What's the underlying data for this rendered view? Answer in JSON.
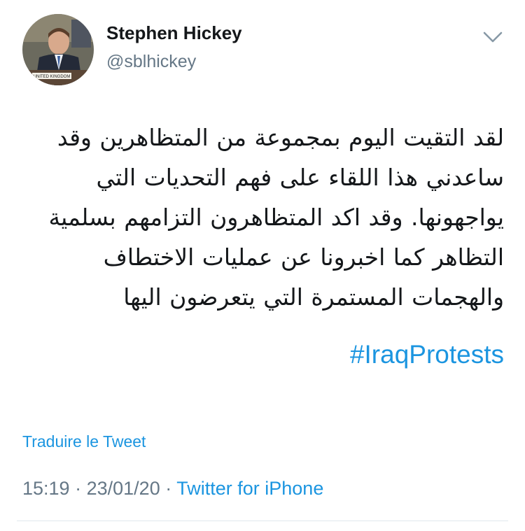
{
  "user": {
    "display_name": "Stephen Hickey",
    "handle": "@sblhickey",
    "avatar_placard_text": "UNITED KINGDOM"
  },
  "tweet": {
    "text_lines": [
      "لقد التقيت اليوم بمجموعة من المتظاهرين وقد",
      "ساعدني هذا اللقاء على فهم التحديات التي",
      "يواجهونها. وقد اكد المتظاهرون التزامهم بسلمية",
      "التظاهر كما اخبرونا عن عمليات الاختطاف",
      "والهجمات المستمرة التي يتعرضون اليها"
    ],
    "hashtag": "#IraqProtests",
    "translate_label": "Traduire le Tweet"
  },
  "meta": {
    "time": "15:19",
    "separator": "·",
    "date": "23/01/20",
    "source": "Twitter for iPhone"
  },
  "icons": {
    "menu": "chevron-down-icon"
  },
  "colors": {
    "link": "#1b95e0",
    "secondary_text": "#657786",
    "primary_text": "#14171a",
    "divider": "#e1e8ed"
  }
}
